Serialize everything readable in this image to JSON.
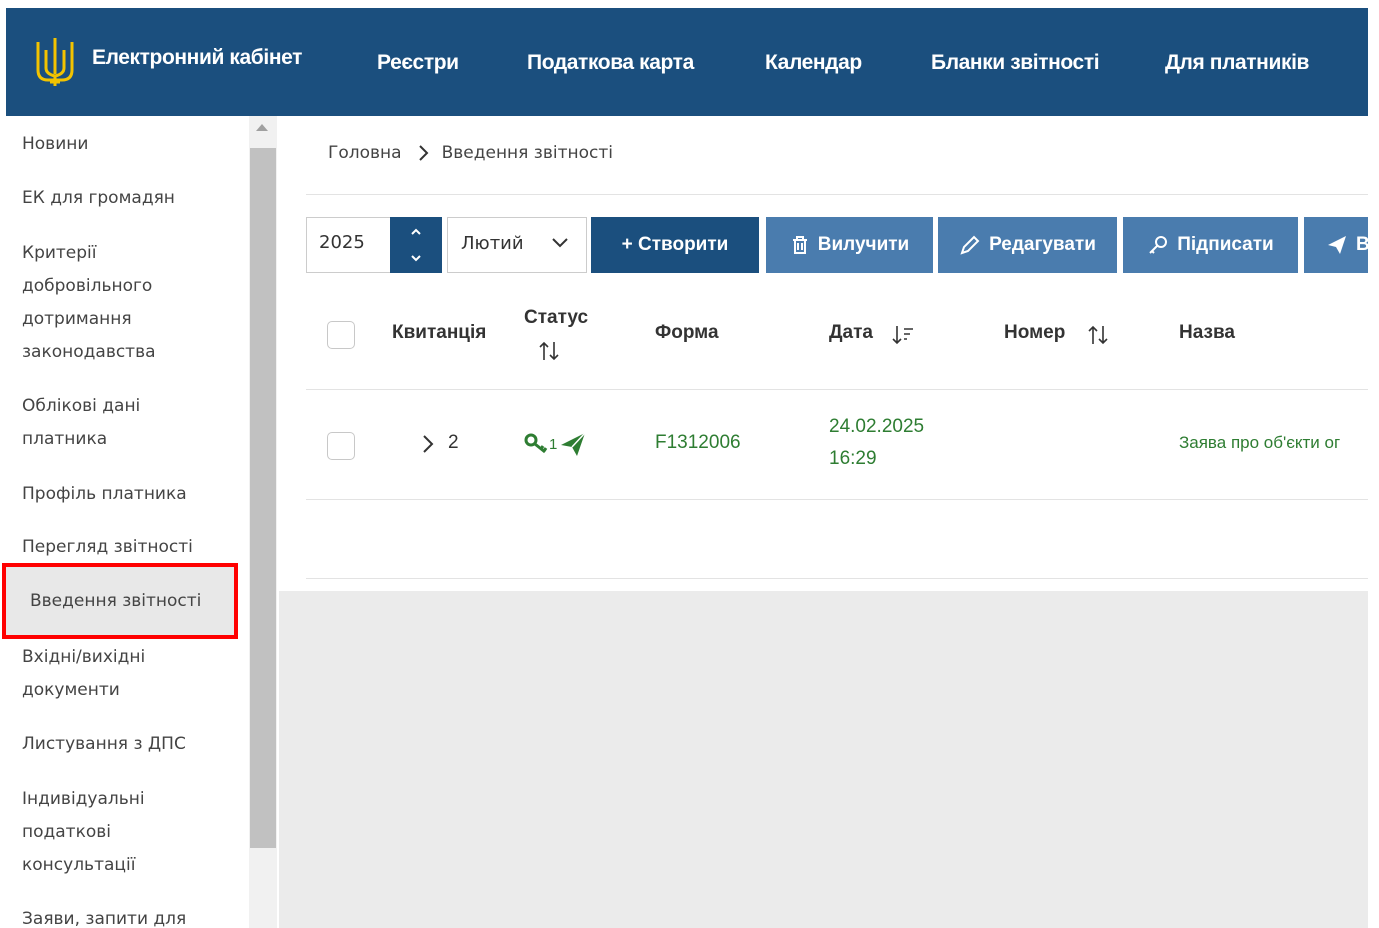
{
  "header": {
    "brand": "Електронний кабінет",
    "nav": [
      "Реєстри",
      "Податкова карта",
      "Календар",
      "Бланки звітності",
      "Для платників"
    ],
    "bg_color": "#1b4f7e"
  },
  "sidebar": {
    "items": [
      "Новини",
      "ЕК для громадян",
      "Критерії добровільного дотримання законодавства",
      "Облікові дані платника",
      "Профіль платника",
      "Перегляд звітності",
      "Введення звітності",
      "Вхідні/вихідні документи",
      "Листування з ДПС",
      "Індивідуальні податкові консультації",
      "Заяви, запити для"
    ],
    "active": "Введення звітності"
  },
  "breadcrumb": {
    "home": "Головна",
    "current": "Введення звітності"
  },
  "toolbar": {
    "year": "2025",
    "month": "Лютий",
    "create": "+ Створити",
    "delete": "Вилучити",
    "edit": "Редагувати",
    "sign": "Підписати",
    "send": "В"
  },
  "table": {
    "headers": {
      "receipt": "Квитанція",
      "status": "Статус",
      "form": "Форма",
      "date": "Дата",
      "number": "Номер",
      "name": "Назва"
    },
    "rows": [
      {
        "receipt_count": "2",
        "status_count": "1",
        "form": "F1312006",
        "date": "24.02.2025",
        "time": "16:29",
        "number": "",
        "name": "Заява про об'єкти ог"
      }
    ]
  },
  "colors": {
    "primary": "#1b4f7e",
    "secondary": "#4a7cae",
    "green": "#2e7d32",
    "highlight": "#ff0000"
  }
}
